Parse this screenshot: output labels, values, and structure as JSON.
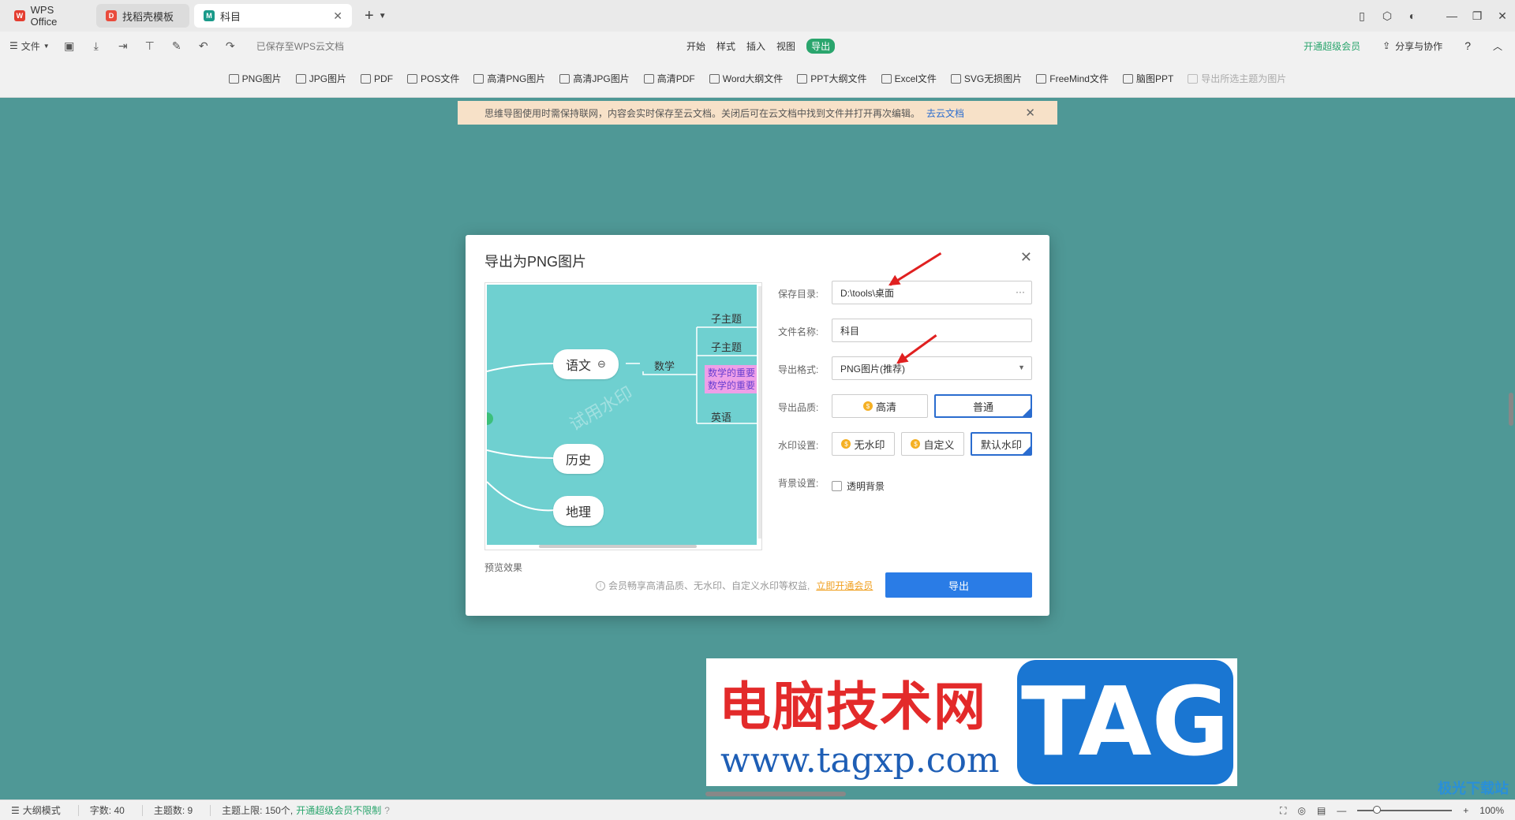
{
  "tabs": [
    {
      "label": "WPS Office"
    },
    {
      "label": "找稻壳模板"
    },
    {
      "label": "科目"
    }
  ],
  "toolbar": {
    "file_label": "文件",
    "saved_status": "已保存至WPS云文档",
    "top_tabs": [
      "开始",
      "样式",
      "插入",
      "视图",
      "导出"
    ],
    "vip_label": "开通超级会员",
    "share_label": "分享与协作"
  },
  "export_items": [
    {
      "label": "PNG图片",
      "icon": "PNG"
    },
    {
      "label": "JPG图片",
      "icon": "JPG"
    },
    {
      "label": "PDF",
      "icon": "P"
    },
    {
      "label": "POS文件",
      "icon": "POS"
    },
    {
      "label": "高清PNG图片",
      "icon": "H"
    },
    {
      "label": "高清JPG图片",
      "icon": "H"
    },
    {
      "label": "高清PDF",
      "icon": "H"
    },
    {
      "label": "Word大纲文件",
      "icon": "W"
    },
    {
      "label": "PPT大纲文件",
      "icon": "P"
    },
    {
      "label": "Excel文件",
      "icon": "X"
    },
    {
      "label": "SVG无损图片",
      "icon": "S"
    },
    {
      "label": "FreeMind文件",
      "icon": "F"
    },
    {
      "label": "脑图PPT",
      "icon": "P"
    },
    {
      "label": "导出所选主题为图片",
      "icon": "I",
      "disabled": true
    }
  ],
  "notice": {
    "text": "思维导图使用时需保持联网，内容会实时保存至云文档。关闭后可在云文档中找到文件并打开再次编辑。",
    "link": "去云文档"
  },
  "dialog": {
    "title": "导出为PNG图片",
    "preview": {
      "nodes": [
        "语文",
        "历史",
        "地理"
      ],
      "branch": "数学",
      "subs": [
        "子主题",
        "子主题",
        "数学的重要",
        "数学的重要",
        "英语"
      ],
      "watermark": "试用水印",
      "label": "预览效果"
    },
    "save_dir_label": "保存目录:",
    "save_dir_value": "D:\\tools\\桌面",
    "save_dir_more": "···",
    "file_name_label": "文件名称:",
    "file_name_value": "科目",
    "format_label": "导出格式:",
    "format_value": "PNG图片(推荐)",
    "quality_label": "导出品质:",
    "quality_options": [
      "高清",
      "普通"
    ],
    "watermark_label": "水印设置:",
    "watermark_options": [
      "无水印",
      "自定义",
      "默认水印"
    ],
    "bg_label": "背景设置:",
    "bg_option": "透明背景",
    "member_tip": "会员畅享高清品质、无水印、自定义水印等权益,",
    "member_link": "立即开通会员",
    "export_button": "导出"
  },
  "overlay": {
    "title": "电脑技术网",
    "url": "www.tagxp.com",
    "logo": "TAG",
    "corner": "极光下载站"
  },
  "statusbar": {
    "outline_mode": "大纲模式",
    "word_count": "字数: 40",
    "topic_count": "主题数: 9",
    "topic_limit": "主题上限: 150个,",
    "vip_unlimited": "开通超级会员不限制",
    "zoom": "100%"
  },
  "colors": {
    "canvas": "#4f9896",
    "accent": "#2a7ce6",
    "green": "#2aa56d",
    "preview_bg": "#6fd0d0"
  }
}
